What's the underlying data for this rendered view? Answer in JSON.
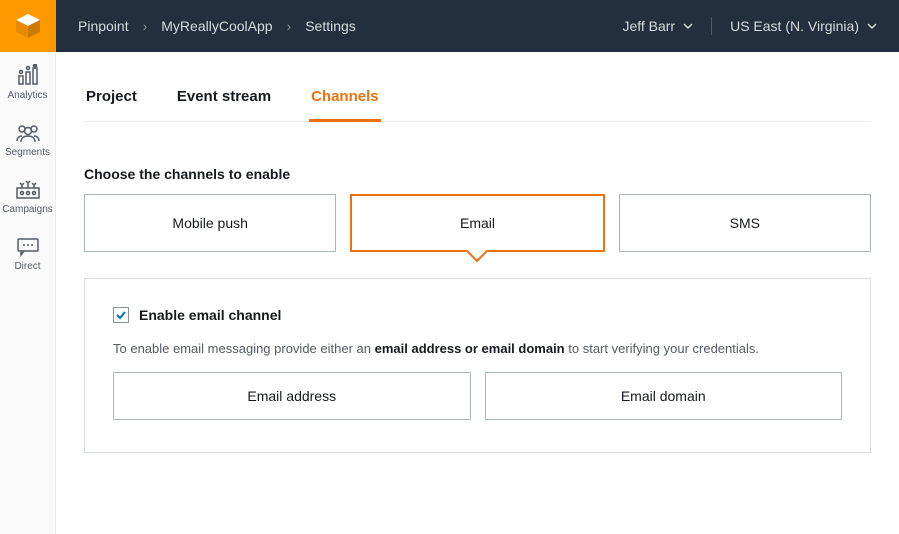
{
  "breadcrumbs": [
    "Pinpoint",
    "MyReallyCoolApp",
    "Settings"
  ],
  "user": "Jeff Barr",
  "region": "US East (N. Virginia)",
  "sidebar": {
    "items": [
      {
        "label": "Analytics"
      },
      {
        "label": "Segments"
      },
      {
        "label": "Campaigns"
      },
      {
        "label": "Direct"
      }
    ]
  },
  "tabs": [
    {
      "label": "Project"
    },
    {
      "label": "Event stream"
    },
    {
      "label": "Channels"
    }
  ],
  "section_heading": "Choose the channels to enable",
  "channels": [
    {
      "label": "Mobile push"
    },
    {
      "label": "Email"
    },
    {
      "label": "SMS"
    }
  ],
  "email_panel": {
    "checkbox_label": "Enable email channel",
    "helper_pre": "To enable email messaging provide either an ",
    "helper_bold": "email address or email domain",
    "helper_post": " to start verifying your credentials.",
    "options": [
      {
        "label": "Email address"
      },
      {
        "label": "Email domain"
      }
    ]
  }
}
